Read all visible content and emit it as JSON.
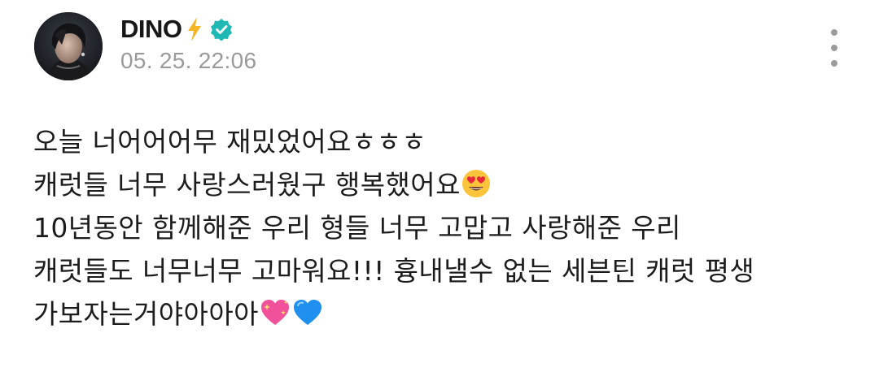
{
  "post": {
    "author": {
      "name": "DINO",
      "badge_icons": [
        "lightning-icon",
        "verified-icon"
      ],
      "badge_colors": {
        "lightning": "#f5b626",
        "verified": "#1fb8b4"
      }
    },
    "timestamp": "05. 25. 22:06",
    "more_menu_icon": "vertical-ellipsis-icon",
    "body_lines": [
      "오늘 너어어어무 재밌었어요ㅎㅎㅎ",
      "캐럿들 너무 사랑스러웠구 행복했어요",
      "10년동안 함께해준 우리 형들 너무 고맙고 사랑해준 우리",
      "캐럿들도 너무너무 고마워요!!! 흉내낼수 없는 세븐틴 캐럿 평생",
      "가보자는거야아아아"
    ],
    "emojis": [
      "heart-eyes-emoji",
      "sparkling-heart-emoji",
      "blue-heart-emoji"
    ]
  }
}
